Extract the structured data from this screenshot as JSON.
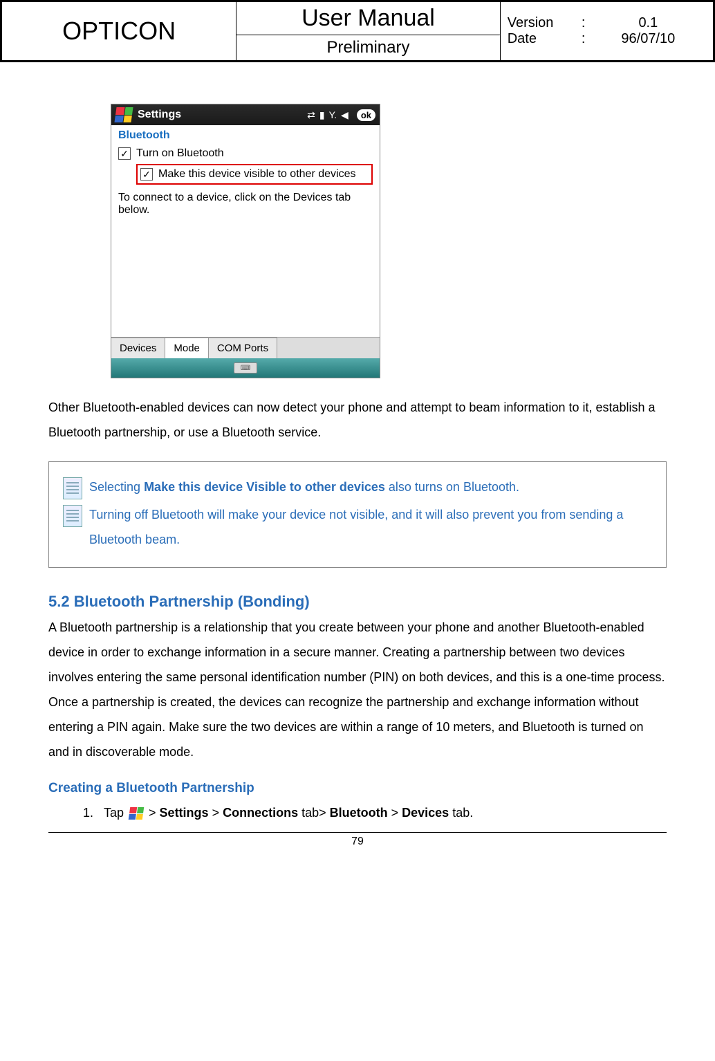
{
  "header": {
    "brand": "OPTICON",
    "title": "User Manual",
    "subtitle": "Preliminary",
    "version_label": "Version",
    "version_value": "0.1",
    "date_label": "Date",
    "date_value": "96/07/10"
  },
  "screenshot": {
    "titlebar": "Settings",
    "ok": "ok",
    "section": "Bluetooth",
    "checkbox1": "Turn on Bluetooth",
    "checkbox2": "Make this device visible to other devices",
    "hint": "To connect to a device, click on the Devices tab below.",
    "tabs": [
      "Devices",
      "Mode",
      "COM Ports"
    ],
    "active_tab_index": 1
  },
  "para1": "Other Bluetooth-enabled devices can now detect your phone and attempt to beam information to it, establish a Bluetooth partnership, or use a Bluetooth service.",
  "notes": {
    "n1_pre": "Selecting ",
    "n1_bold": "Make this device Visible to other devices",
    "n1_post": " also turns on Bluetooth.",
    "n2": "Turning off Bluetooth will make your device not visible, and it will also prevent you from sending a Bluetooth beam."
  },
  "section_heading": "5.2 Bluetooth Partnership (Bonding)",
  "section_body": "A Bluetooth partnership is a relationship that you create between your phone and another Bluetooth-enabled device in order to exchange information in a secure manner. Creating a partnership between two devices involves entering the same personal identification number (PIN) on both devices, and this is a one-time process. Once a partnership is created, the devices can recognize the partnership and exchange information without entering a PIN again. Make sure the two devices are within a range of 10 meters, and Bluetooth is turned on and in discoverable mode.",
  "sub_heading": "Creating a Bluetooth Partnership",
  "step1": {
    "pre": "Tap ",
    "p1": " > ",
    "b1": "Settings",
    "p2": " > ",
    "b2": "Connections",
    "p3": " tab> ",
    "b3": "Bluetooth",
    "p4": " > ",
    "b4": "Devices",
    "p5": " tab."
  },
  "page_number": "79"
}
